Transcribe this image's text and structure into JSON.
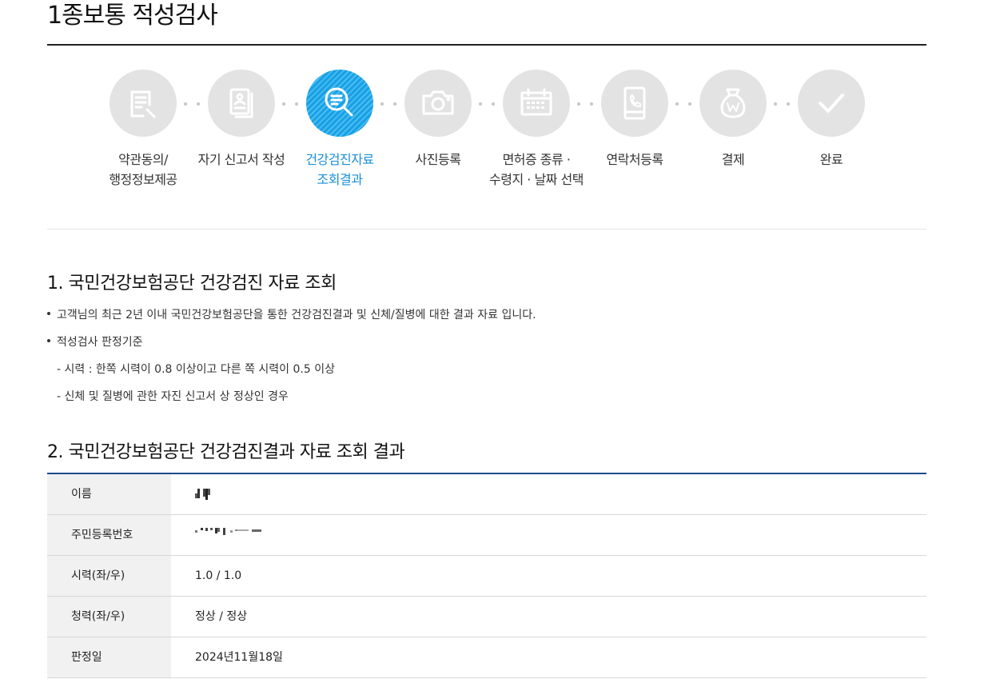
{
  "page": {
    "title": "1종보통 적성검사"
  },
  "steps": [
    {
      "label_1": "약관동의/",
      "label_2": "행정정보제공",
      "icon": "document-pen-icon",
      "state": "done"
    },
    {
      "label_1": "자기 신고서 작성",
      "label_2": "",
      "icon": "report-paper-icon",
      "state": "done"
    },
    {
      "label_1": "건강검진자료",
      "label_2": "조회결과",
      "icon": "magnifier-icon",
      "state": "active"
    },
    {
      "label_1": "사진등록",
      "label_2": "",
      "icon": "camera-icon",
      "state": "pending"
    },
    {
      "label_1": "면허증 종류 ·",
      "label_2": "수령지 · 날짜 선택",
      "icon": "calendar-icon",
      "state": "pending"
    },
    {
      "label_1": "연락처등록",
      "label_2": "",
      "icon": "mobile-phone-icon",
      "state": "pending"
    },
    {
      "label_1": "결제",
      "label_2": "",
      "icon": "money-bag-icon",
      "state": "pending"
    },
    {
      "label_1": "완료",
      "label_2": "",
      "icon": "checkmark-icon",
      "state": "pending"
    }
  ],
  "section1": {
    "heading": "1. 국민건강보험공단 건강검진 자료 조회",
    "bullet1": "고객님의 최근 2년 이내 국민건강보험공단을 통한 건강검진결과 및 신체/질병에 대한 결과 자료 입니다.",
    "bullet2": "적성검사 판정기준",
    "sub1": "- 시력 : 한쪽 시력이 0.8 이상이고 다른 쪽 시력이 0.5 이상",
    "sub2": "- 신체 및 질병에 관한 자진 신고서 상 정상인 경우"
  },
  "section2": {
    "heading": "2. 국민건강보험공단 건강검진결과 자료 조회 결과",
    "rows": [
      {
        "label": "이름",
        "value": ""
      },
      {
        "label": "주민등록번호",
        "value": ""
      },
      {
        "label": "시력(좌/우)",
        "value": "1.0 / 1.0"
      },
      {
        "label": "청력(좌/우)",
        "value": "정상 / 정상"
      },
      {
        "label": "판정일",
        "value": "2024년11월18일"
      }
    ]
  },
  "colors": {
    "active": "#1a8fd8",
    "table_border": "#1d4c8a",
    "circle_inactive": "#e3e3e3"
  }
}
